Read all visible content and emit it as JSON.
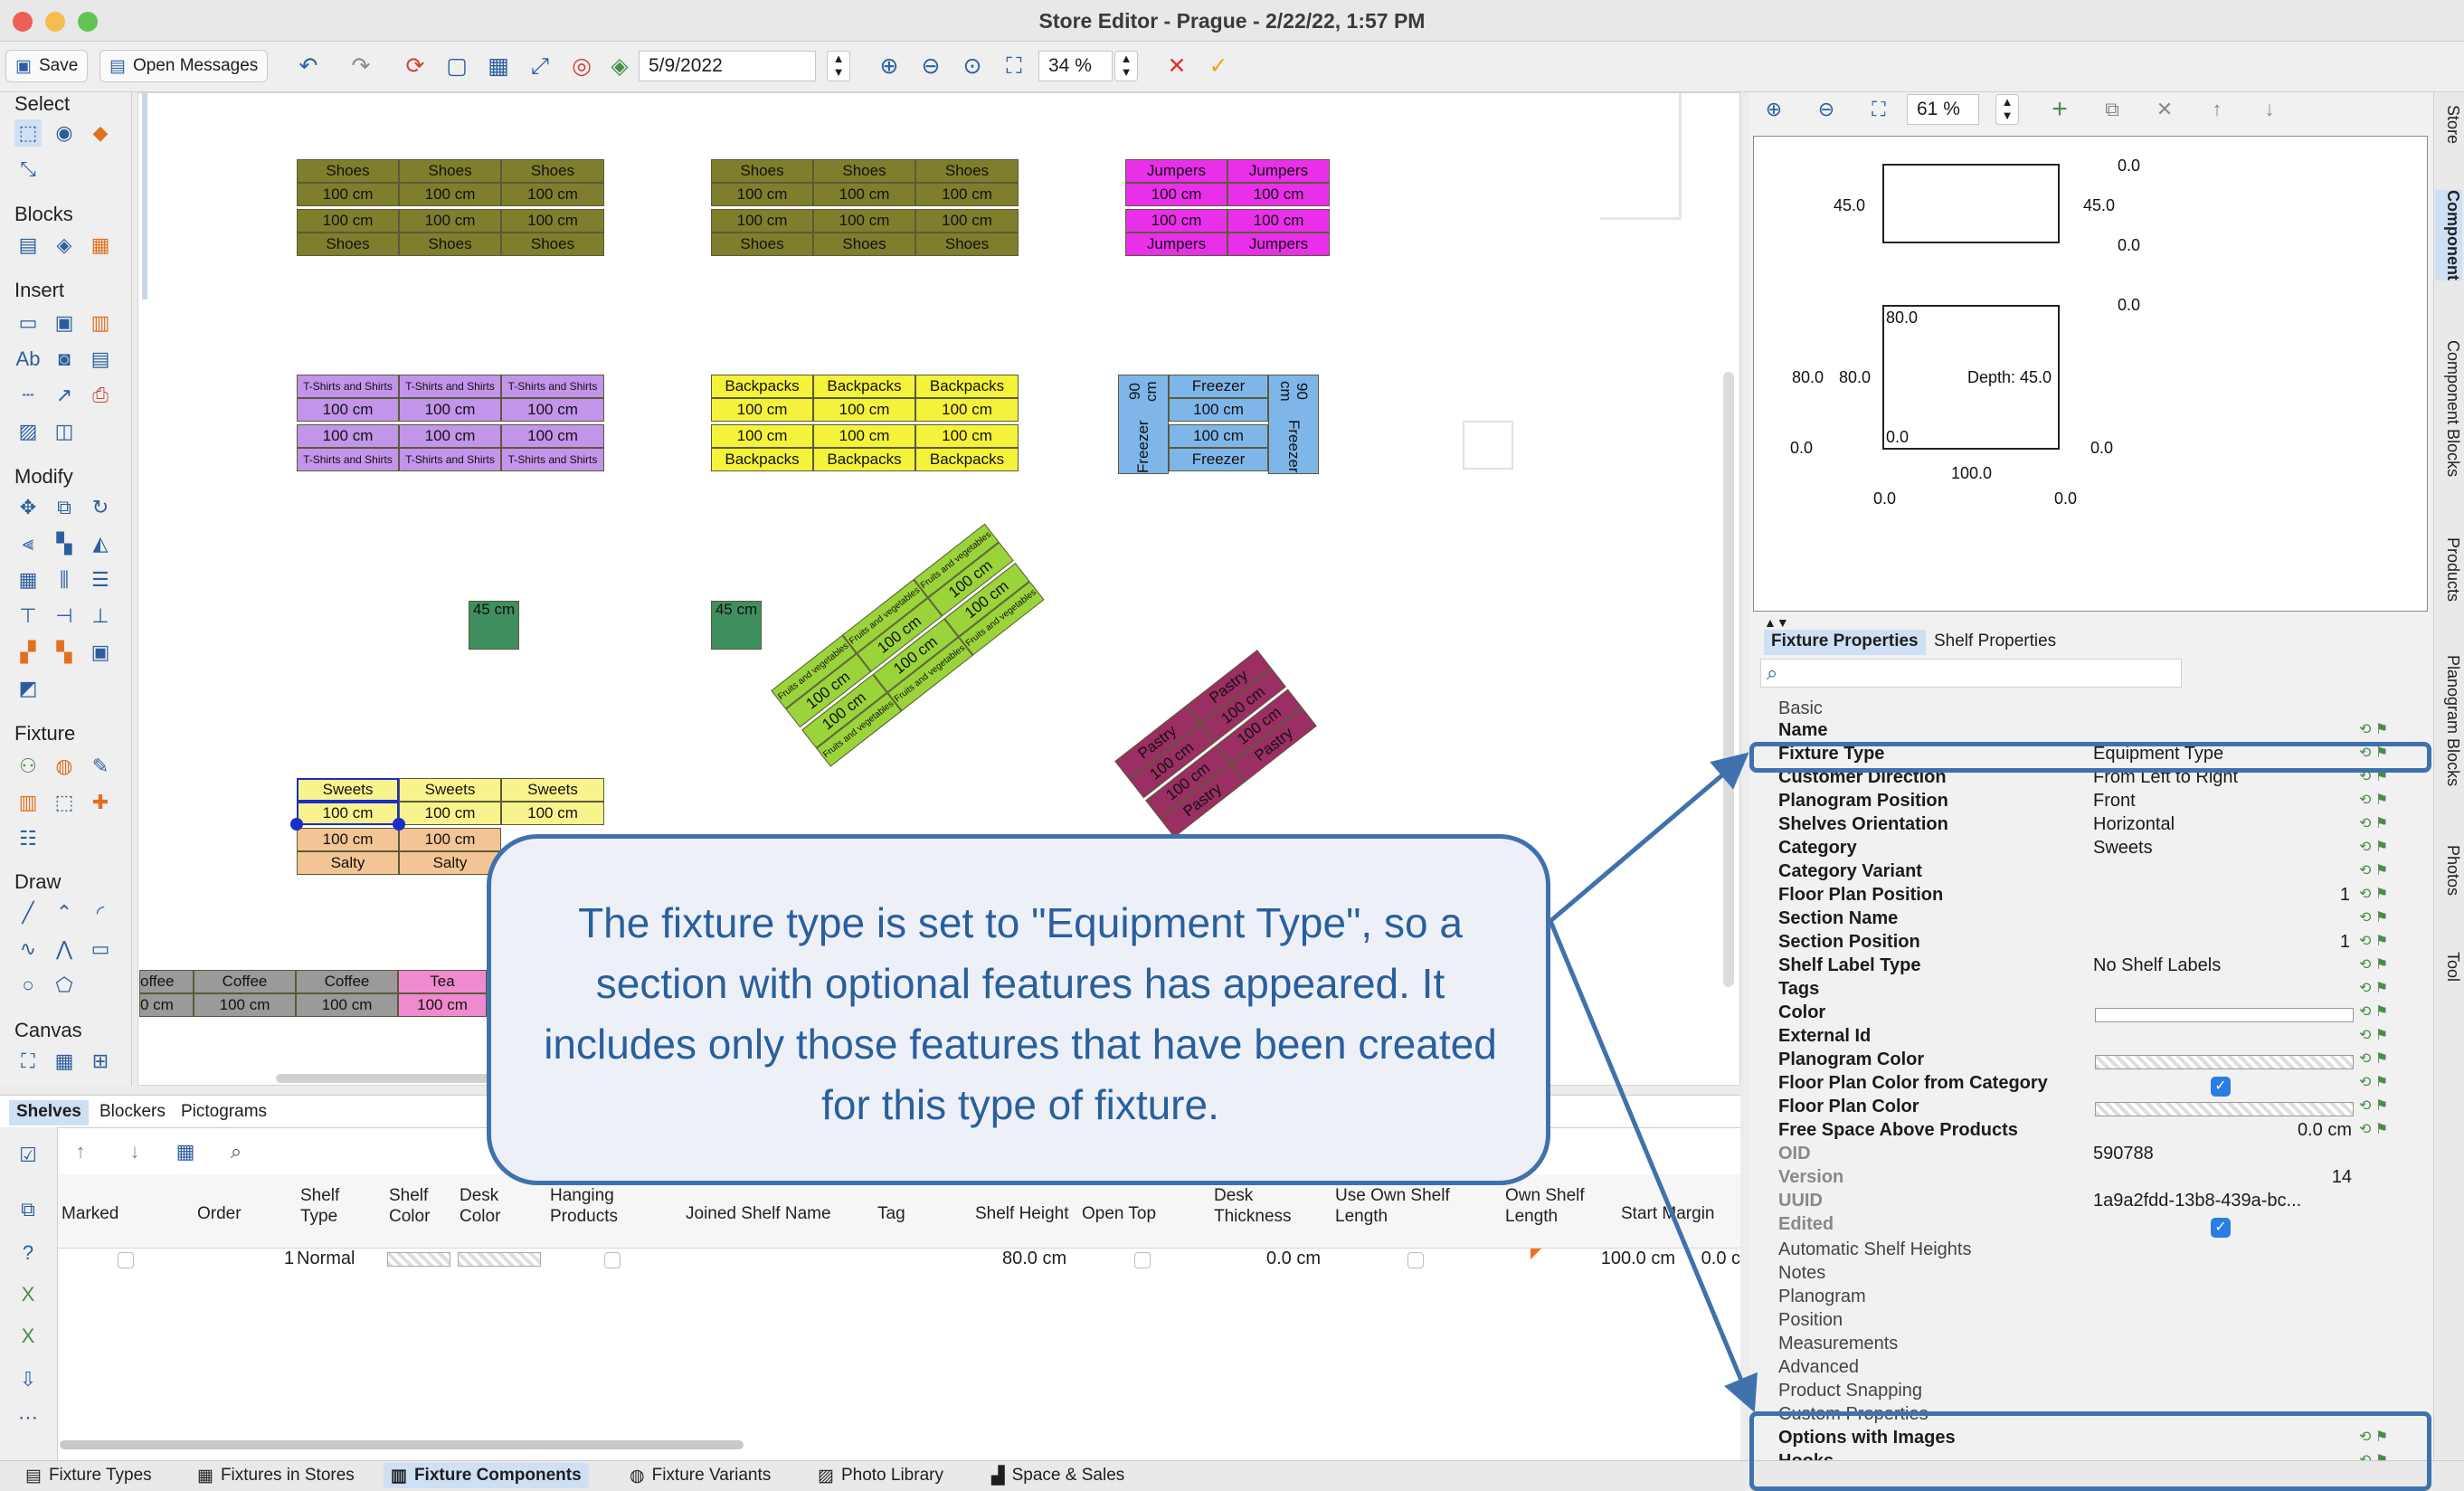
{
  "window": {
    "title": "Store Editor - Prague - 2/22/22, 1:57 PM"
  },
  "toolbar": {
    "save_label": "Save",
    "messages_label": "Open Messages",
    "date_value": "5/9/2022",
    "zoom_value": "34 %"
  },
  "palette": {
    "select": "Select",
    "blocks": "Blocks",
    "insert": "Insert",
    "modify": "Modify",
    "fixture": "Fixture",
    "draw": "Draw",
    "canvas": "Canvas"
  },
  "fixtures": {
    "shoes": "Shoes",
    "len100": "100 cm",
    "jumpers": "Jumpers",
    "tshirts": "T-Shirts and Shirts",
    "backpacks": "Backpacks",
    "freezer": "Freezer",
    "len90": "90 cm",
    "len45": "45 cm",
    "sweets": "Sweets",
    "salty": "Salty",
    "fruits": "Fruits and vegetables",
    "pastry": "Pastry",
    "coffee": "Coffee",
    "coffee_cut": "offee",
    "cm_cut": "0 cm",
    "tea": "Tea"
  },
  "callout": {
    "text": "The fixture type is set to \"Equipment Type\", so a section with optional features has appeared. It includes only those features that have been created for this type of fixture."
  },
  "lower_tabs": [
    "Shelves",
    "Blockers",
    "Pictograms"
  ],
  "shelf_table": {
    "headers": [
      "Marked",
      "Order",
      "Shelf Type",
      "Shelf Color",
      "Desk Color",
      "Hanging Products",
      "Joined Shelf Name",
      "Tag",
      "Shelf Height",
      "Open Top",
      "Desk Thickness",
      "Use Own Shelf Length",
      "Own Shelf Length",
      "Start Margin"
    ],
    "row": {
      "order": "1",
      "type": "Normal",
      "height": "80.0 cm",
      "desk_thickness": "0.0 cm",
      "own_length": "100.0 cm",
      "start_margin": "0.0 c"
    }
  },
  "bottom_tabs": [
    "Fixture Types",
    "Fixtures in Stores",
    "Fixture Components",
    "Fixture Variants",
    "Photo Library",
    "Space & Sales"
  ],
  "right": {
    "zoom": "61 %",
    "dims": {
      "top_right": "0.0",
      "left45": "45.0",
      "right45": "45.0",
      "mid_right": "0.0",
      "box2_right": "0.0",
      "h80a": "80.0",
      "h80b": "80.0",
      "inner80": "80.0",
      "depth": "Depth: 45.0",
      "inner0": "0.0",
      "left0": "0.0",
      "right0": "0.0",
      "width100": "100.0",
      "bottom_left": "0.0",
      "bottom_right": "0.0"
    },
    "tabs": [
      "Fixture Properties",
      "Shelf Properties"
    ],
    "props": {
      "basic": "Basic",
      "rows": [
        {
          "label": "Name",
          "value": ""
        },
        {
          "label": "Fixture Type",
          "value": "Equipment Type"
        },
        {
          "label": "Customer Direction",
          "value": "From Left to Right"
        },
        {
          "label": "Planogram Position",
          "value": "Front"
        },
        {
          "label": "Shelves Orientation",
          "value": "Horizontal"
        },
        {
          "label": "Category",
          "value": "Sweets"
        },
        {
          "label": "Category Variant",
          "value": ""
        },
        {
          "label": "Floor Plan Position",
          "value": "1"
        },
        {
          "label": "Section Name",
          "value": ""
        },
        {
          "label": "Section Position",
          "value": "1"
        },
        {
          "label": "Shelf Label Type",
          "value": "No Shelf Labels"
        },
        {
          "label": "Tags",
          "value": ""
        },
        {
          "label": "Color",
          "value": ""
        },
        {
          "label": "External Id",
          "value": ""
        },
        {
          "label": "Planogram Color",
          "value": ""
        },
        {
          "label": "Floor Plan Color from Category",
          "value": ""
        },
        {
          "label": "Floor Plan Color",
          "value": ""
        },
        {
          "label": "Free Space Above Products",
          "value": "0.0 cm"
        },
        {
          "label": "OID",
          "value": "590788"
        },
        {
          "label": "Version",
          "value": "14"
        },
        {
          "label": "UUID",
          "value": "1a9a2fdd-13b8-439a-bc..."
        },
        {
          "label": "Edited",
          "value": ""
        }
      ],
      "sections": [
        "Automatic Shelf Heights",
        "Notes",
        "Planogram",
        "Position",
        "Measurements",
        "Advanced",
        "Product Snapping"
      ],
      "custom": "Custom Properties",
      "custom_rows": [
        "Options with Images",
        "Hooks"
      ]
    }
  },
  "vertical_tabs": [
    "Store",
    "Component",
    "Component Blocks",
    "Products",
    "Planogram Blocks",
    "Photos",
    "Tool"
  ]
}
